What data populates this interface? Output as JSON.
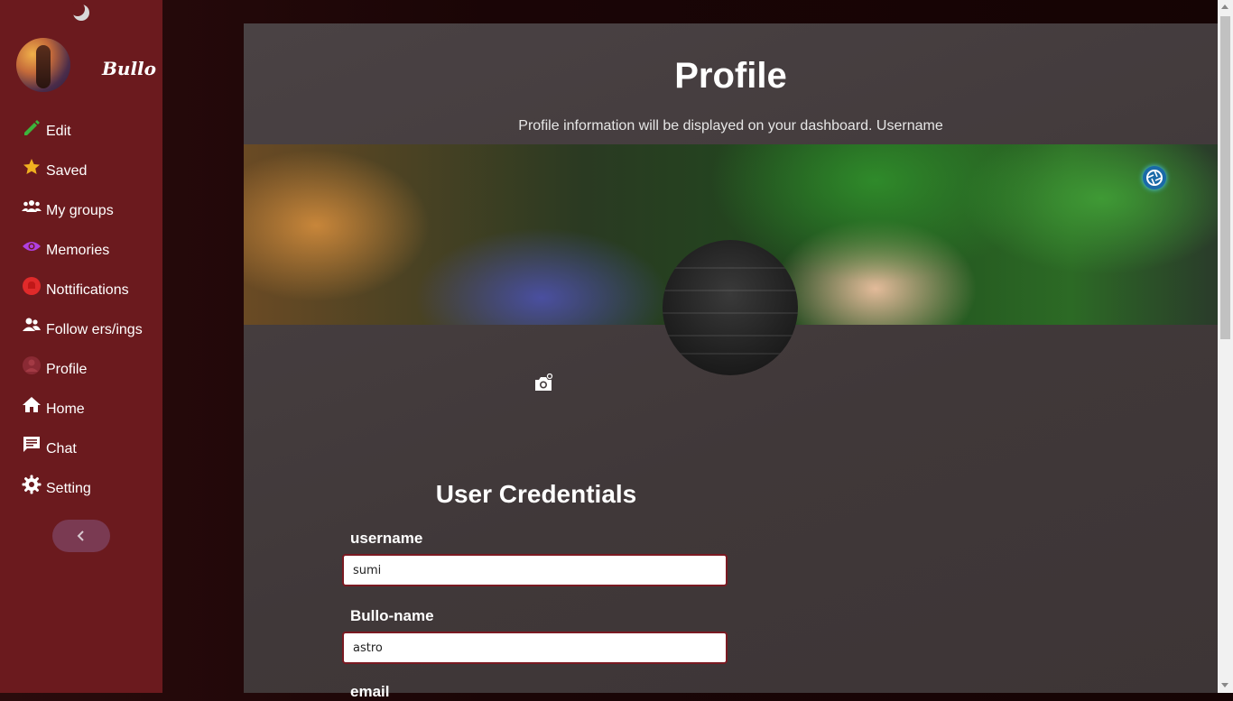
{
  "sidebar": {
    "brand": "Bullo",
    "items": [
      {
        "label": "Edit",
        "icon": "pencil-icon",
        "color": "#3cb43c"
      },
      {
        "label": "Saved",
        "icon": "star-icon",
        "color": "#f0b020"
      },
      {
        "label": "My groups",
        "icon": "group-icon",
        "color": "#ffffff"
      },
      {
        "label": "Memories",
        "icon": "eye-icon",
        "color": "#b040e0"
      },
      {
        "label": "Nottifications",
        "icon": "bell-icon",
        "color": "#e02a2a"
      },
      {
        "label": "Follow ers/ings",
        "icon": "people-icon",
        "color": "#ffffff"
      },
      {
        "label": "Profile",
        "icon": "user-icon",
        "color": "#8a2a34"
      },
      {
        "label": "Home",
        "icon": "home-icon",
        "color": "#ffffff"
      },
      {
        "label": "Chat",
        "icon": "chat-icon",
        "color": "#ffffff"
      },
      {
        "label": "Setting",
        "icon": "gear-icon",
        "color": "#ffffff"
      }
    ]
  },
  "main": {
    "title": "Profile",
    "subtitle": "Profile information will be displayed on your dashboard. Username",
    "credentials": {
      "title": "User Credentials",
      "fields": [
        {
          "label": "username",
          "value": "sumi"
        },
        {
          "label": "Bullo-name",
          "value": "astro"
        },
        {
          "label": "email",
          "value": ""
        }
      ]
    }
  }
}
